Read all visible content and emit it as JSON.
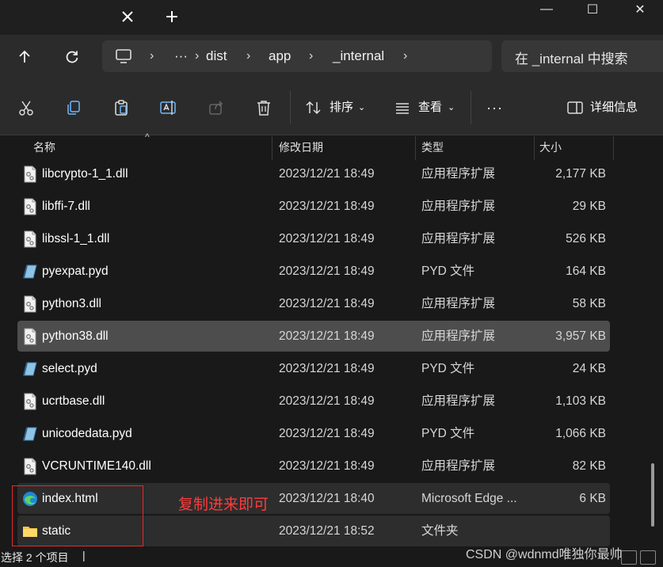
{
  "window": {
    "minimize_label": "—",
    "maximize_label": "☐",
    "close_label": "✕"
  },
  "address": {
    "more_label": "···",
    "crumbs": [
      "dist",
      "app",
      "_internal"
    ],
    "search_placeholder": "在 _internal 中搜索"
  },
  "toolbar": {
    "sort_label": "排序",
    "view_label": "查看",
    "more_label": "···",
    "details_label": "详细信息"
  },
  "columns": {
    "name": "名称",
    "modified": "修改日期",
    "type": "类型",
    "size": "大小"
  },
  "files": [
    {
      "name": "libcrypto-1_1.dll",
      "date": "2023/12/21 18:49",
      "type": "应用程序扩展",
      "size": "2,177 KB",
      "icon": "dll-file-icon"
    },
    {
      "name": "libffi-7.dll",
      "date": "2023/12/21 18:49",
      "type": "应用程序扩展",
      "size": "29 KB",
      "icon": "dll-file-icon"
    },
    {
      "name": "libssl-1_1.dll",
      "date": "2023/12/21 18:49",
      "type": "应用程序扩展",
      "size": "526 KB",
      "icon": "dll-file-icon"
    },
    {
      "name": "pyexpat.pyd",
      "date": "2023/12/21 18:49",
      "type": "PYD 文件",
      "size": "164 KB",
      "icon": "pyd-file-icon"
    },
    {
      "name": "python3.dll",
      "date": "2023/12/21 18:49",
      "type": "应用程序扩展",
      "size": "58 KB",
      "icon": "dll-file-icon"
    },
    {
      "name": "python38.dll",
      "date": "2023/12/21 18:49",
      "type": "应用程序扩展",
      "size": "3,957 KB",
      "icon": "dll-file-icon"
    },
    {
      "name": "select.pyd",
      "date": "2023/12/21 18:49",
      "type": "PYD 文件",
      "size": "24 KB",
      "icon": "pyd-file-icon"
    },
    {
      "name": "ucrtbase.dll",
      "date": "2023/12/21 18:49",
      "type": "应用程序扩展",
      "size": "1,103 KB",
      "icon": "dll-file-icon"
    },
    {
      "name": "unicodedata.pyd",
      "date": "2023/12/21 18:49",
      "type": "PYD 文件",
      "size": "1,066 KB",
      "icon": "pyd-file-icon"
    },
    {
      "name": "VCRUNTIME140.dll",
      "date": "2023/12/21 18:49",
      "type": "应用程序扩展",
      "size": "82 KB",
      "icon": "dll-file-icon"
    },
    {
      "name": "index.html",
      "date": "2023/12/21 18:40",
      "type": "Microsoft Edge ...",
      "size": "6 KB",
      "icon": "edge-html-icon"
    },
    {
      "name": "static",
      "date": "2023/12/21 18:52",
      "type": "文件夹",
      "size": "",
      "icon": "folder-icon"
    }
  ],
  "annotation": "复制进来即可",
  "status": "选择 2 个项目",
  "status_caret": "|",
  "watermark": "CSDN @wdnmd唯独你最帅",
  "colors": {
    "background": "#191919",
    "toolbar": "#2b2b2b",
    "selected_row": "#4d4d4d",
    "annotation_red": "#e22c2c",
    "folder_yellow": "#f3c64b"
  }
}
